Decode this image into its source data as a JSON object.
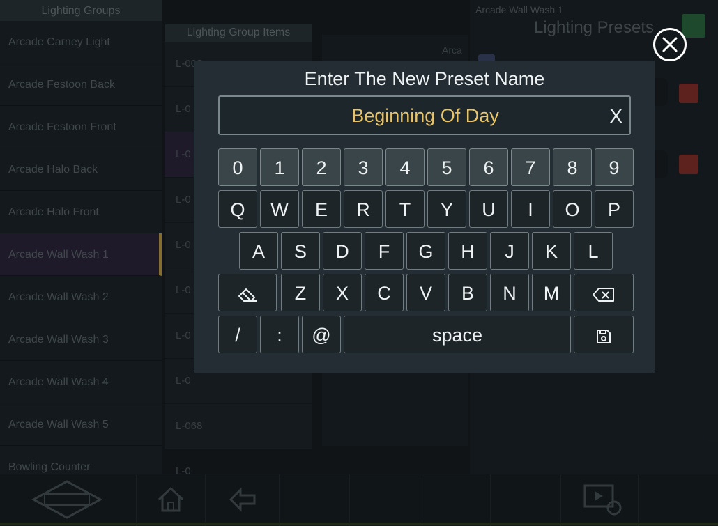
{
  "background": {
    "groups_header": "Lighting Groups",
    "groups": [
      "Arcade Carney Light",
      "Arcade Festoon Back",
      "Arcade Festoon Front",
      "Arcade Halo Back",
      "Arcade Halo Front",
      "Arcade Wall Wash 1",
      "Arcade Wall Wash 2",
      "Arcade Wall Wash 3",
      "Arcade Wall Wash 4",
      "Arcade Wall Wash 5",
      "Bowling Counter"
    ],
    "group_items_header": "Lighting Group Items",
    "group_items": [
      "L-003",
      "L-0",
      "L-0",
      "L-0",
      "L-0",
      "L-0",
      "L-0",
      "L-0",
      "L-068",
      "L-0"
    ],
    "mid_label": "Arca",
    "presets_subtitle": "Arcade Wall Wash 1",
    "presets_title": "Lighting Presets"
  },
  "dialog": {
    "title": "Enter The New Preset Name",
    "value": "Beginning Of Day",
    "clear_label": "X"
  },
  "keyboard": {
    "row_numbers": [
      "0",
      "1",
      "2",
      "3",
      "4",
      "5",
      "6",
      "7",
      "8",
      "9"
    ],
    "row_top": [
      "Q",
      "W",
      "E",
      "R",
      "T",
      "Y",
      "U",
      "I",
      "O",
      "P"
    ],
    "row_home": [
      "A",
      "S",
      "D",
      "F",
      "G",
      "H",
      "J",
      "K",
      "L"
    ],
    "row_bottom": [
      "Z",
      "X",
      "C",
      "V",
      "B",
      "N",
      "M"
    ],
    "slash": "/",
    "colon": ":",
    "at": "@",
    "space": "space",
    "erase_icon": "eraser-icon",
    "backspace_icon": "backspace-icon",
    "save_icon": "save-icon"
  },
  "icons": {
    "close": "close-icon",
    "home": "home-icon",
    "back": "back-arrow-icon",
    "media": "media-play-icon",
    "logo": "logo-icon"
  },
  "colors": {
    "input_text": "#e7c36a",
    "dialog_bg": "#232d33",
    "selected_group": "#2a2238",
    "accent_yellow": "#c8a33c"
  }
}
